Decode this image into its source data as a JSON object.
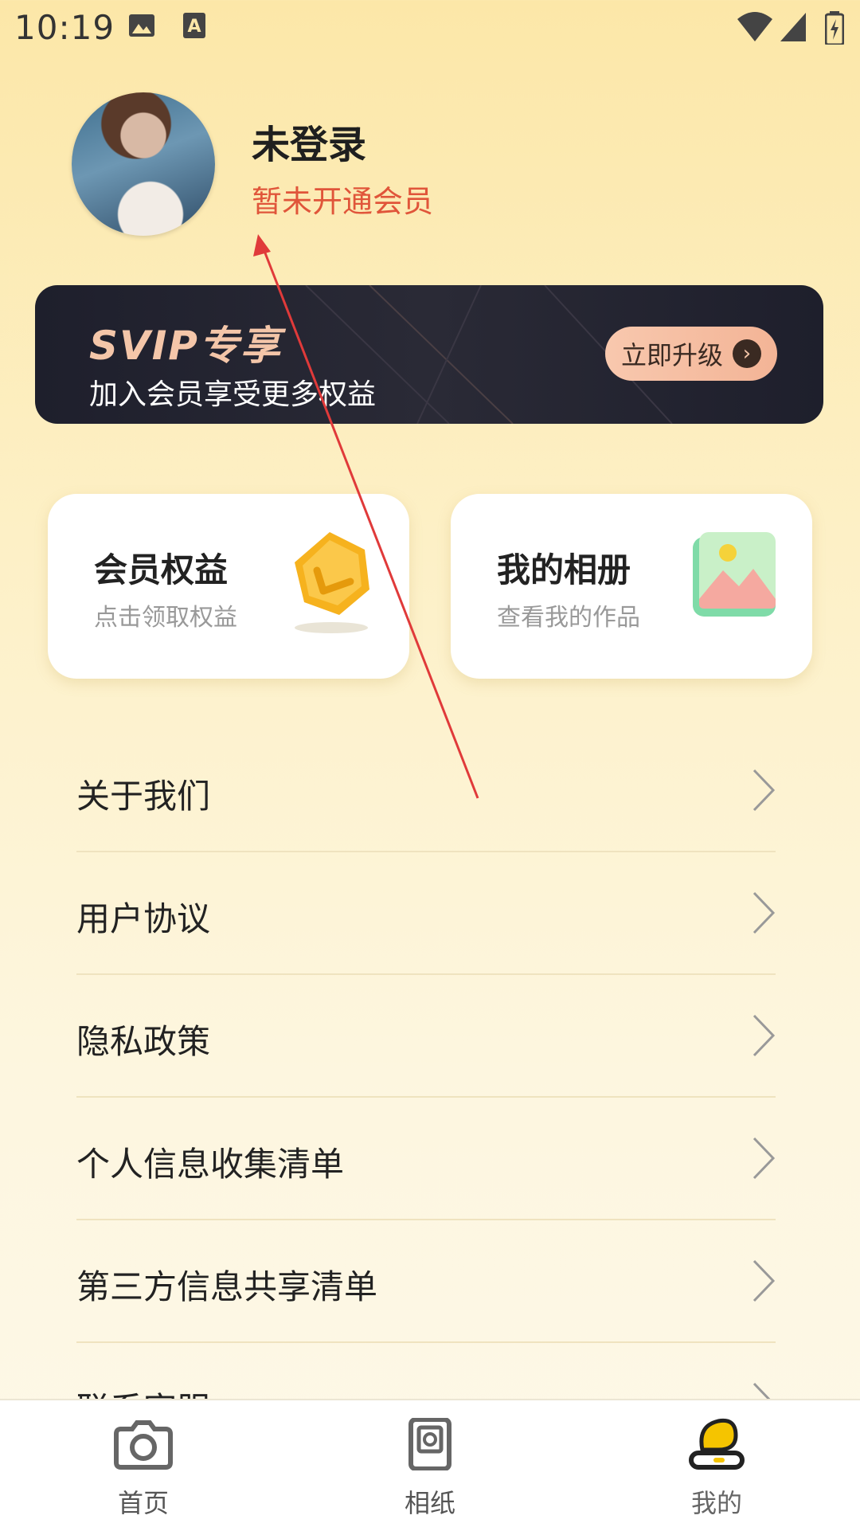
{
  "status_bar": {
    "time": "10:19",
    "icons": [
      "image-icon",
      "text-a-icon",
      "wifi-icon",
      "signal-icon",
      "battery-icon"
    ]
  },
  "profile": {
    "name": "未登录",
    "vip_status": "暂未开通会员"
  },
  "svip_banner": {
    "title": "SVIP专享",
    "subtitle": "加入会员享受更多权益",
    "button_label": "立即升级"
  },
  "cards": [
    {
      "title": "会员权益",
      "subtitle": "点击领取权益",
      "icon": "member-badge-icon"
    },
    {
      "title": "我的相册",
      "subtitle": "查看我的作品",
      "icon": "photo-album-icon"
    }
  ],
  "menu": {
    "items": [
      {
        "label": "关于我们"
      },
      {
        "label": "用户协议"
      },
      {
        "label": "隐私政策"
      },
      {
        "label": "个人信息收集清单"
      },
      {
        "label": "第三方信息共享清单"
      },
      {
        "label": "联系客服"
      }
    ]
  },
  "bottom_nav": {
    "tabs": [
      {
        "label": "首页",
        "icon": "camera-icon",
        "active": false
      },
      {
        "label": "相纸",
        "icon": "photo-paper-icon",
        "active": false
      },
      {
        "label": "我的",
        "icon": "profile-icon",
        "active": true
      }
    ]
  },
  "colors": {
    "accent_red": "#e0553a",
    "active_tab": "#f5c400",
    "banner_bg": "#1e1f2c"
  }
}
